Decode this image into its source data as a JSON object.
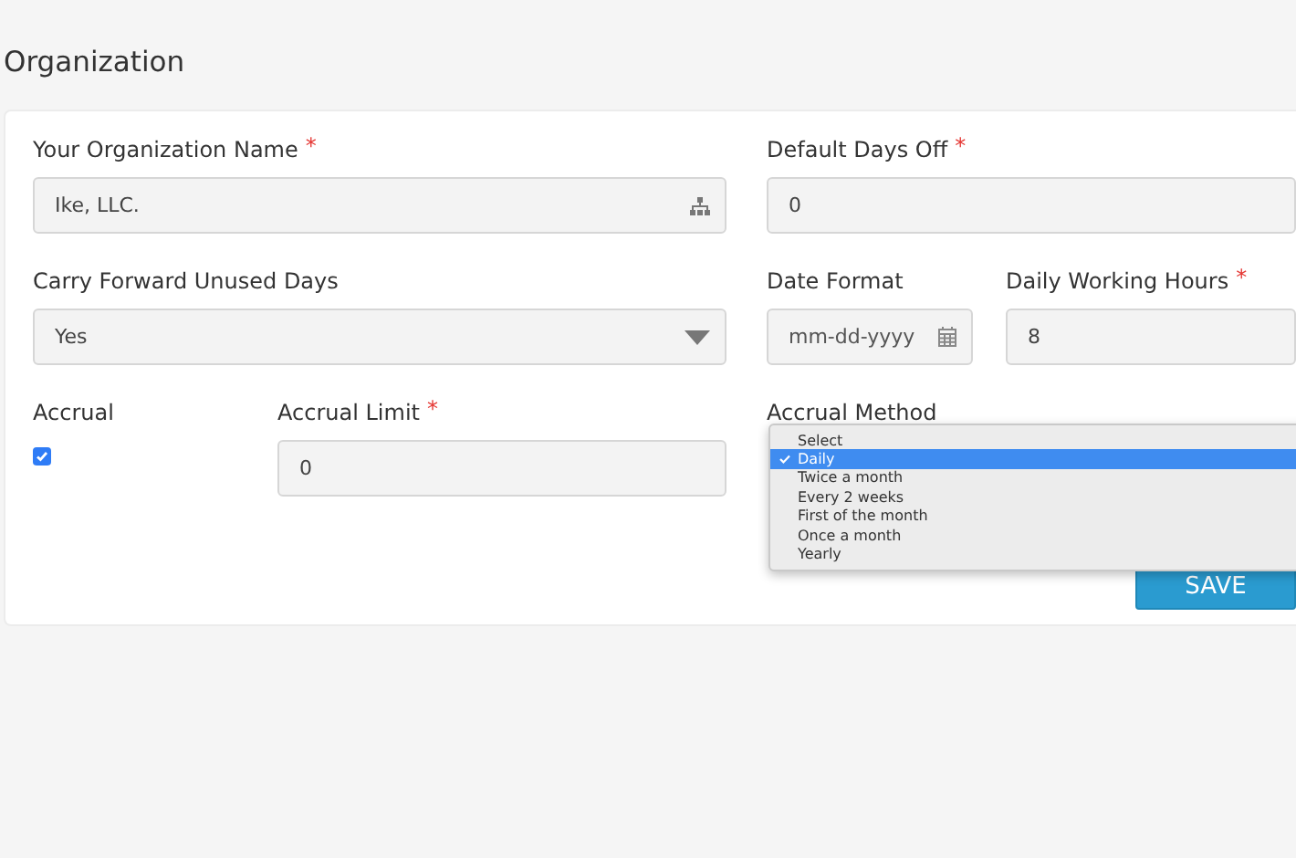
{
  "page_title": "Organization",
  "rows": [
    {
      "left": [
        {
          "kind": "text_with_icon",
          "label": "Your Organization Name",
          "required_mark": "*",
          "value": "Ike, LLC."
        }
      ],
      "right": [
        {
          "kind": "text",
          "label": "Default Days Off",
          "required_mark": "*",
          "value": "0"
        }
      ]
    },
    {
      "left": [
        {
          "kind": "select",
          "label": "Carry Forward Unused Days",
          "value": "Yes"
        }
      ],
      "right": [
        {
          "kind": "date",
          "label": "Date Format",
          "placeholder": "mm-dd-yyyy"
        },
        {
          "kind": "text",
          "label": "Daily Working Hours",
          "required_mark": "*",
          "value": "8"
        }
      ]
    },
    {
      "left": [
        {
          "kind": "checkbox",
          "label": "Accrual",
          "checked": true
        },
        {
          "kind": "text",
          "label": "Accrual Limit",
          "required_mark": "*",
          "value": "0"
        }
      ],
      "right": [
        {
          "kind": "label",
          "label": "Accrual Method"
        }
      ]
    }
  ],
  "dropdown": {
    "options": [
      {
        "label": "Select",
        "selected": false
      },
      {
        "label": "Daily",
        "selected": true
      },
      {
        "label": "Twice a month",
        "selected": false
      },
      {
        "label": "Every 2 weeks",
        "selected": false
      },
      {
        "label": "First of the month",
        "selected": false
      },
      {
        "label": "Once a month",
        "selected": false
      },
      {
        "label": "Yearly",
        "selected": false
      }
    ]
  },
  "save_button": "SAVE"
}
